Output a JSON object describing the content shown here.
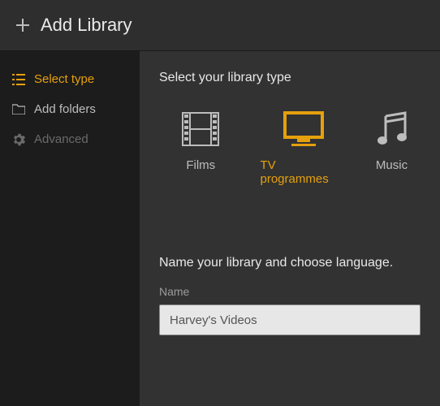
{
  "title": "Add Library",
  "sidebar": {
    "items": [
      {
        "label": "Select type"
      },
      {
        "label": "Add folders"
      },
      {
        "label": "Advanced"
      }
    ]
  },
  "main": {
    "select_prompt": "Select your library type",
    "types": [
      {
        "label": "Films"
      },
      {
        "label": "TV programmes"
      },
      {
        "label": "Music"
      }
    ],
    "name_prompt": "Name your library and choose language.",
    "name_field_label": "Name",
    "name_value": "Harvey's Videos"
  }
}
